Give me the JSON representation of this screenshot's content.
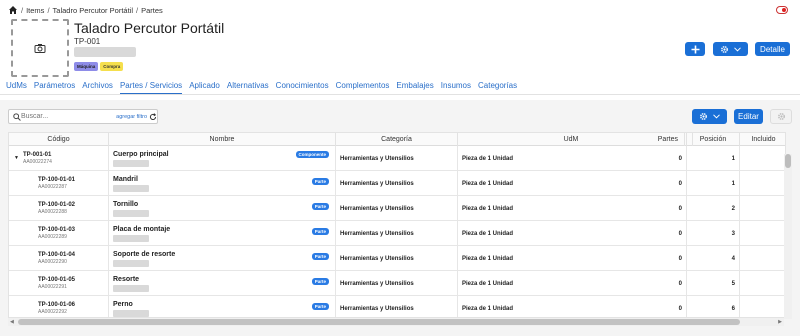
{
  "breadcrumb": [
    "Items",
    "Taladro Percutor Portátil",
    "Partes"
  ],
  "item": {
    "title": "Taladro Percutor Portátil",
    "code": "TP-001",
    "badges": [
      "Máquina",
      "Compra"
    ]
  },
  "header_buttons": {
    "detail": "Detalle"
  },
  "tabs": [
    "UdMs",
    "Parámetros",
    "Archivos",
    "Partes / Servicios",
    "Aplicado",
    "Alternativas",
    "Conocimientos",
    "Complementos",
    "Embalajes",
    "Insumos",
    "Categorías"
  ],
  "active_tab": "Partes / Servicios",
  "search": {
    "placeholder": "Buscar...",
    "add_filter": "agregar filtro"
  },
  "toolbar": {
    "edit": "Editar"
  },
  "columns": [
    "Código",
    "Nombre",
    "Categoría",
    "UdM",
    "Partes",
    "Posición",
    "Incluido"
  ],
  "rows": [
    {
      "code": "TP-001-01",
      "sub": "AA00022274",
      "name": "Cuerpo principal",
      "tag": "Componente",
      "category": "Herramientas y Utensilios",
      "udm": "Pieza de 1 Unidad",
      "parts": "0",
      "position": "1",
      "expanded": true
    },
    {
      "code": "TP-100-01-01",
      "sub": "AA00022287",
      "name": "Mandril",
      "tag": "Parte",
      "category": "Herramientas y Utensilios",
      "udm": "Pieza de 1 Unidad",
      "parts": "0",
      "position": "1"
    },
    {
      "code": "TP-100-01-02",
      "sub": "AA00022288",
      "name": "Tornillo",
      "tag": "Parte",
      "category": "Herramientas y Utensilios",
      "udm": "Pieza de 1 Unidad",
      "parts": "0",
      "position": "2"
    },
    {
      "code": "TP-100-01-03",
      "sub": "AA00022289",
      "name": "Placa de montaje",
      "tag": "Parte",
      "category": "Herramientas y Utensilios",
      "udm": "Pieza de 1 Unidad",
      "parts": "0",
      "position": "3"
    },
    {
      "code": "TP-100-01-04",
      "sub": "AA00022290",
      "name": "Soporte de resorte",
      "tag": "Parte",
      "category": "Herramientas y Utensilios",
      "udm": "Pieza de 1 Unidad",
      "parts": "0",
      "position": "4"
    },
    {
      "code": "TP-100-01-05",
      "sub": "AA00022291",
      "name": "Resorte",
      "tag": "Parte",
      "category": "Herramientas y Utensilios",
      "udm": "Pieza de 1 Unidad",
      "parts": "0",
      "position": "5"
    },
    {
      "code": "TP-100-01-06",
      "sub": "AA00022292",
      "name": "Perno",
      "tag": "Parte",
      "category": "Herramientas y Utensilios",
      "udm": "Pieza de 1 Unidad",
      "parts": "0",
      "position": "6"
    }
  ]
}
